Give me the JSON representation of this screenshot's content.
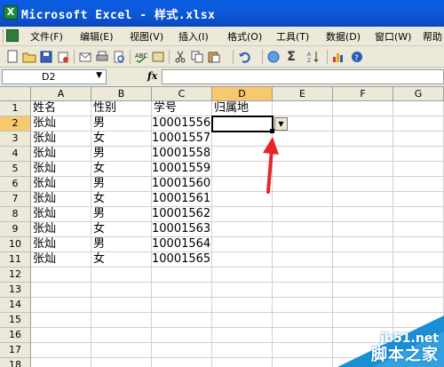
{
  "window": {
    "app_icon": "excel-app-icon",
    "title": "Microsoft Excel - 样式.xlsx"
  },
  "menu": {
    "items": [
      "文件(F)",
      "编辑(E)",
      "视图(V)",
      "插入(I)",
      "格式(O)",
      "工具(T)",
      "数据(D)",
      "窗口(W)",
      "帮助"
    ]
  },
  "toolbar": {
    "icons": [
      "new-icon",
      "open-icon",
      "save-icon",
      "permission-icon",
      "email-icon",
      "print-icon",
      "print-preview-icon",
      "spelling-icon",
      "research-icon",
      "cut-icon",
      "copy-icon",
      "paste-icon",
      "undo-icon",
      "hyperlink-icon",
      "autosum-icon",
      "sort-ascending-icon",
      "chart-wizard-icon",
      "help-icon"
    ],
    "autosum_glyph": "Σ"
  },
  "formula_bar": {
    "name_box": "D2",
    "fx_label": "fx",
    "formula_value": ""
  },
  "sheet": {
    "columns": [
      "A",
      "B",
      "C",
      "D",
      "E",
      "F",
      "G"
    ],
    "active_column": "D",
    "rows": [
      {
        "num": "1",
        "cells": [
          "姓名",
          "性别",
          "学号",
          "归属地",
          "",
          "",
          ""
        ]
      },
      {
        "num": "2",
        "cells": [
          "张灿",
          "男",
          "10001556",
          "",
          "",
          "",
          ""
        ]
      },
      {
        "num": "3",
        "cells": [
          "张灿",
          "女",
          "10001557",
          "",
          "",
          "",
          ""
        ]
      },
      {
        "num": "4",
        "cells": [
          "张灿",
          "男",
          "10001558",
          "",
          "",
          "",
          ""
        ]
      },
      {
        "num": "5",
        "cells": [
          "张灿",
          "女",
          "10001559",
          "",
          "",
          "",
          ""
        ]
      },
      {
        "num": "6",
        "cells": [
          "张灿",
          "男",
          "10001560",
          "",
          "",
          "",
          ""
        ]
      },
      {
        "num": "7",
        "cells": [
          "张灿",
          "女",
          "10001561",
          "",
          "",
          "",
          ""
        ]
      },
      {
        "num": "8",
        "cells": [
          "张灿",
          "男",
          "10001562",
          "",
          "",
          "",
          ""
        ]
      },
      {
        "num": "9",
        "cells": [
          "张灿",
          "女",
          "10001563",
          "",
          "",
          "",
          ""
        ]
      },
      {
        "num": "10",
        "cells": [
          "张灿",
          "男",
          "10001564",
          "",
          "",
          "",
          ""
        ]
      },
      {
        "num": "11",
        "cells": [
          "张灿",
          "女",
          "10001565",
          "",
          "",
          "",
          ""
        ]
      },
      {
        "num": "12",
        "cells": [
          "",
          "",
          "",
          "",
          "",
          "",
          ""
        ]
      },
      {
        "num": "13",
        "cells": [
          "",
          "",
          "",
          "",
          "",
          "",
          ""
        ]
      },
      {
        "num": "14",
        "cells": [
          "",
          "",
          "",
          "",
          "",
          "",
          ""
        ]
      },
      {
        "num": "15",
        "cells": [
          "",
          "",
          "",
          "",
          "",
          "",
          ""
        ]
      },
      {
        "num": "16",
        "cells": [
          "",
          "",
          "",
          "",
          "",
          "",
          ""
        ]
      },
      {
        "num": "17",
        "cells": [
          "",
          "",
          "",
          "",
          "",
          "",
          ""
        ]
      },
      {
        "num": "18",
        "cells": [
          "",
          "",
          "",
          "",
          "",
          "",
          ""
        ]
      }
    ],
    "selected_cell": "D2",
    "selected_row": "2"
  },
  "annotation": {
    "arrow_color": "#e8252a"
  },
  "watermark": {
    "site": "jb51.net",
    "name": "脚本之家"
  },
  "colors": {
    "titlebar": "#0a5de2",
    "chrome": "#ece9d8",
    "active_header": "#f7c86d",
    "watermark": "#1b8fd4"
  }
}
